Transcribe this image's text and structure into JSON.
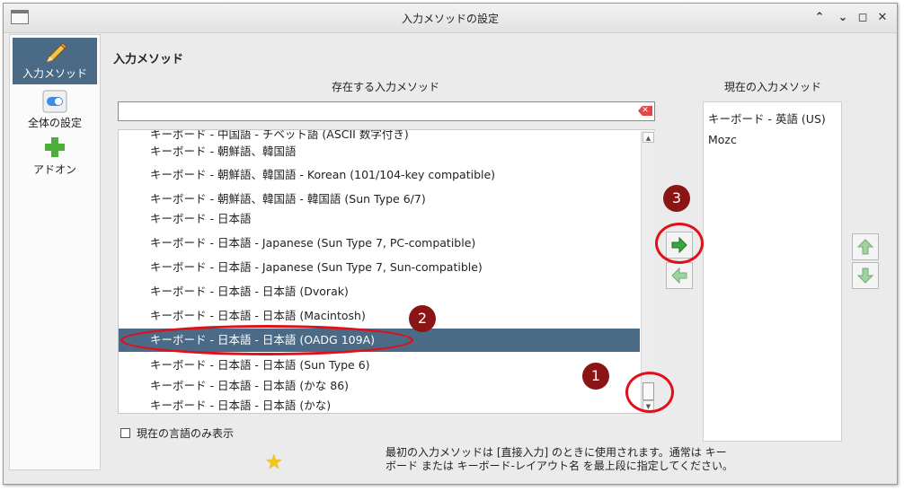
{
  "window": {
    "title": "入力メソッドの設定",
    "controls": [
      "minimize",
      "restore",
      "maximize",
      "close"
    ]
  },
  "sidebar": {
    "items": [
      {
        "label": "入力メソッド",
        "icon": "pencil-icon",
        "active": true
      },
      {
        "label": "全体の設定",
        "icon": "toggle-icon",
        "active": false
      },
      {
        "label": "アドオン",
        "icon": "plus-icon",
        "active": false
      }
    ]
  },
  "main": {
    "section_title": "入力メソッド",
    "available_label": "存在する入力メソッド",
    "current_label": "現在の入力メソッド",
    "search": {
      "value": "",
      "placeholder": ""
    },
    "available_items": [
      "キーボード - 中国語 - チベット語 (ASCII 数字付き)",
      "キーボード - 朝鮮語、韓国語",
      "キーボード - 朝鮮語、韓国語 - Korean (101/104-key compatible)",
      "キーボード - 朝鮮語、韓国語 - 韓国語 (Sun Type 6/7)",
      "キーボード - 日本語",
      "キーボード - 日本語 - Japanese (Sun Type 7, PC-compatible)",
      "キーボード - 日本語 - Japanese (Sun Type 7, Sun-compatible)",
      "キーボード - 日本語 - 日本語 (Dvorak)",
      "キーボード - 日本語 - 日本語 (Macintosh)",
      "キーボード - 日本語 - 日本語 (OADG 109A)",
      "キーボード - 日本語 - 日本語 (Sun Type 6)",
      "キーボード - 日本語 - 日本語 (かな 86)",
      "キーボード - 日本語 - 日本語 (かな)"
    ],
    "selected_index": 9,
    "current_items": [
      "キーボード - 英語 (US)",
      "Mozc"
    ],
    "checkbox": {
      "label": "現在の言語のみ表示",
      "checked": false
    },
    "help_text_line1": "最初の入力メソッドは [直接入力] のときに使用されます。通常は キー",
    "help_text_line2": "ボード または キーボード-レイアウト名 を最上段に指定してください。"
  },
  "annotations": [
    "1",
    "2",
    "3"
  ],
  "colors": {
    "selection": "#4a6a85",
    "annotation": "#e0101a",
    "badge": "#8b1515",
    "arrow_green": "#3aa83a"
  }
}
